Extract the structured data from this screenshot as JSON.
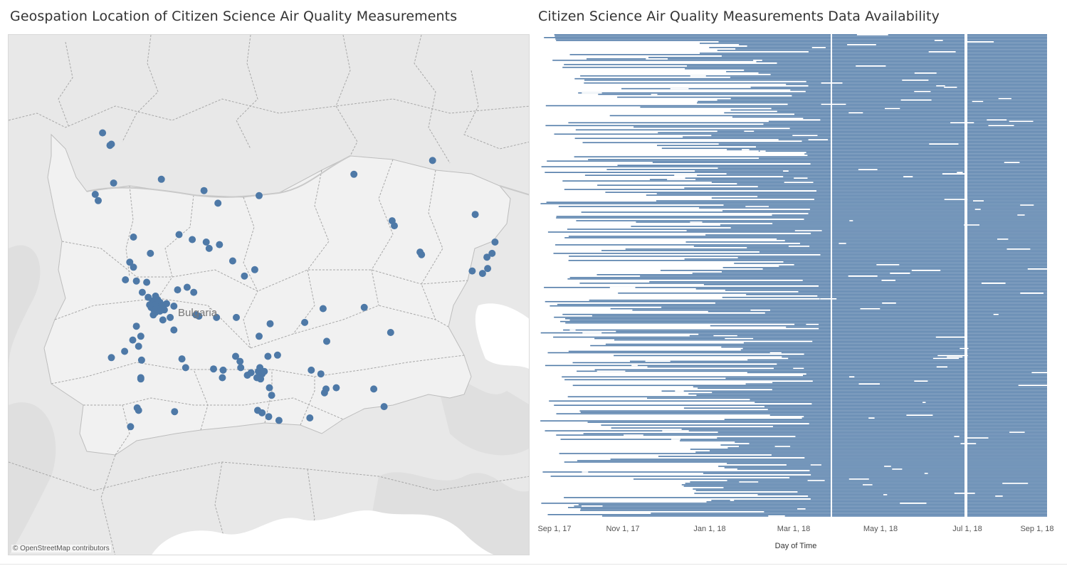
{
  "map": {
    "title": "Geospation Location of Citizen Science Air Quality Measurements",
    "country_label": "Bulgaria",
    "attribution": "© OpenStreetMap contributors"
  },
  "availability": {
    "title": "Citizen Science Air Quality Measurements Data Availability",
    "x_label": "Day of Time"
  },
  "colors": {
    "accent": "#4e79a7",
    "map_land": "#e8e8e8",
    "map_country": "#f2f2f2",
    "border": "#b5b5b5"
  },
  "chart_data": [
    {
      "type": "scatter",
      "title": "Geospation Location of Citizen Science Air Quality Measurements",
      "x_field": "Longitude",
      "y_field": "Latitude",
      "points": [
        [
          22.58,
          44.07
        ],
        [
          22.68,
          43.97
        ],
        [
          22.7,
          43.98
        ],
        [
          22.48,
          43.58
        ],
        [
          22.52,
          43.53
        ],
        [
          22.73,
          43.67
        ],
        [
          23.38,
          43.7
        ],
        [
          23.96,
          43.61
        ],
        [
          24.71,
          43.57
        ],
        [
          24.15,
          43.51
        ],
        [
          26.0,
          43.74
        ],
        [
          27.07,
          43.85
        ],
        [
          26.52,
          43.37
        ],
        [
          26.55,
          43.33
        ],
        [
          27.65,
          43.42
        ],
        [
          27.92,
          43.2
        ],
        [
          27.81,
          43.08
        ],
        [
          27.88,
          43.11
        ],
        [
          27.82,
          42.99
        ],
        [
          27.75,
          42.95
        ],
        [
          27.61,
          42.97
        ],
        [
          26.9,
          43.12
        ],
        [
          26.92,
          43.1
        ],
        [
          23.8,
          43.22
        ],
        [
          23.62,
          43.26
        ],
        [
          23.0,
          43.24
        ],
        [
          22.95,
          43.04
        ],
        [
          23.23,
          43.11
        ],
        [
          23.99,
          43.2
        ],
        [
          24.17,
          43.18
        ],
        [
          24.03,
          43.15
        ],
        [
          24.35,
          43.05
        ],
        [
          24.65,
          42.98
        ],
        [
          24.51,
          42.93
        ],
        [
          23.3,
          42.77
        ],
        [
          23.36,
          42.72
        ],
        [
          23.32,
          42.69
        ],
        [
          23.28,
          42.66
        ],
        [
          23.38,
          42.7
        ],
        [
          23.26,
          42.73
        ],
        [
          23.42,
          42.66
        ],
        [
          23.33,
          42.74
        ],
        [
          23.24,
          42.68
        ],
        [
          23.3,
          42.64
        ],
        [
          23.45,
          42.71
        ],
        [
          23.34,
          42.68
        ],
        [
          23.29,
          42.7
        ],
        [
          23.31,
          42.67
        ],
        [
          23.36,
          42.65
        ],
        [
          23.4,
          42.69
        ],
        [
          23.22,
          42.7
        ],
        [
          23.27,
          42.62
        ],
        [
          23.2,
          42.76
        ],
        [
          23.12,
          42.8
        ],
        [
          23.04,
          42.89
        ],
        [
          22.89,
          42.9
        ],
        [
          23.18,
          42.88
        ],
        [
          23.4,
          42.58
        ],
        [
          23.5,
          42.6
        ],
        [
          23.55,
          42.69
        ],
        [
          23.6,
          42.82
        ],
        [
          23.73,
          42.84
        ],
        [
          23.82,
          42.8
        ],
        [
          23.55,
          42.5
        ],
        [
          23.04,
          42.53
        ],
        [
          22.99,
          42.42
        ],
        [
          23.07,
          42.37
        ],
        [
          23.11,
          42.26
        ],
        [
          23.1,
          42.12
        ],
        [
          23.1,
          42.11
        ],
        [
          22.7,
          42.28
        ],
        [
          22.88,
          42.33
        ],
        [
          23.05,
          41.88
        ],
        [
          23.07,
          41.86
        ],
        [
          23.56,
          41.85
        ],
        [
          22.96,
          41.73
        ],
        [
          23.66,
          42.27
        ],
        [
          23.71,
          42.2
        ],
        [
          24.09,
          42.19
        ],
        [
          24.22,
          42.18
        ],
        [
          24.21,
          42.12
        ],
        [
          24.39,
          42.29
        ],
        [
          24.45,
          42.25
        ],
        [
          24.46,
          42.2
        ],
        [
          24.55,
          42.14
        ],
        [
          24.6,
          42.16
        ],
        [
          24.75,
          42.15
        ],
        [
          24.73,
          42.11
        ],
        [
          24.7,
          42.17
        ],
        [
          24.68,
          42.12
        ],
        [
          24.72,
          42.2
        ],
        [
          24.78,
          42.17
        ],
        [
          24.83,
          42.29
        ],
        [
          24.96,
          42.3
        ],
        [
          24.85,
          42.04
        ],
        [
          24.69,
          41.86
        ],
        [
          24.75,
          41.84
        ],
        [
          24.84,
          41.81
        ],
        [
          24.98,
          41.78
        ],
        [
          24.4,
          42.6
        ],
        [
          24.13,
          42.6
        ],
        [
          23.89,
          42.61
        ],
        [
          24.71,
          42.45
        ],
        [
          24.86,
          42.55
        ],
        [
          25.33,
          42.56
        ],
        [
          25.58,
          42.67
        ],
        [
          25.63,
          42.41
        ],
        [
          26.14,
          42.68
        ],
        [
          26.5,
          42.48
        ],
        [
          25.42,
          42.18
        ],
        [
          25.55,
          42.15
        ],
        [
          25.76,
          42.04
        ],
        [
          25.6,
          42.0
        ],
        [
          25.62,
          42.03
        ],
        [
          26.27,
          42.03
        ],
        [
          26.41,
          41.89
        ],
        [
          25.4,
          41.8
        ],
        [
          24.88,
          41.98
        ],
        [
          23.85,
          42.62
        ],
        [
          23.0,
          43.0
        ],
        [
          23.1,
          42.45
        ]
      ]
    },
    {
      "type": "heatmap",
      "title": "Citizen Science Air Quality Measurements Data Availability",
      "x_field": "Day of Time",
      "x_range": [
        "2017-09-01",
        "2018-09-01"
      ],
      "x_ticks": [
        "Sep 1, 17",
        "Nov 1, 17",
        "Jan 1, 18",
        "Mar 1, 18",
        "May 1, 18",
        "Jul 1, 18",
        "Sep 1, 18"
      ],
      "xlabel": "Day of Time",
      "rows": 340,
      "data_start_date": "2017-09-04",
      "data_end_date": "2018-08-26",
      "global_gaps": [
        [
          "2018-03-27",
          "2018-03-28"
        ],
        [
          "2018-06-29",
          "2018-07-01"
        ]
      ]
    }
  ]
}
